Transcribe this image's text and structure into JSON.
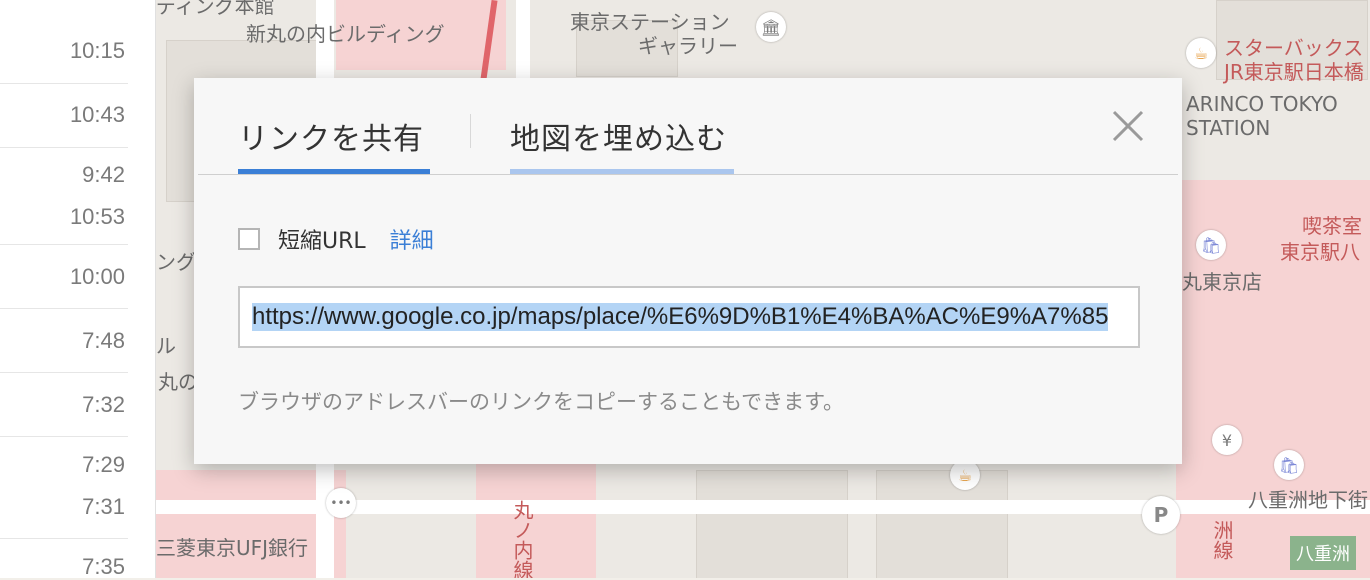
{
  "left_panel": {
    "times": [
      "10:15",
      "10:43",
      "9:42",
      "10:53",
      "10:00",
      "7:48",
      "7:32",
      "7:29",
      "7:31",
      "7:35"
    ]
  },
  "map": {
    "labels": {
      "building_top": "ディング本館",
      "shinmarunouchi": "新丸の内ビルディング",
      "station_gallery_1": "東京ステーション",
      "station_gallery_2": "ギャラリー",
      "starbucks_1": "スターバックス",
      "starbucks_2": "JR東京駅日本橋",
      "arinco_1": "ARINCO TOKYO",
      "arinco_2": "STATION",
      "kissa_1": "喫茶室",
      "kissa_2": "東京駅八",
      "daimaru": "丸東京店",
      "left_ng": "ング",
      "left_ru": "ル",
      "left_maruno": "丸の",
      "mufg": "三菱東京UFJ銀行",
      "marunouchi_line": "丸ノ内線",
      "yaesu_chika": "八重洲地下街",
      "yaesu_line": "洲線",
      "yaesu_badge": "八重洲"
    },
    "icons": [
      "museum-icon",
      "cafe-icon",
      "shopping-bag-icon",
      "yen-icon",
      "parking-icon",
      "traffic-light-icon"
    ]
  },
  "dialog": {
    "tabs": [
      {
        "label": "リンクを共有",
        "underline_color": "#3b7fd6"
      },
      {
        "label": "地図を埋め込む",
        "underline_color": "#aac6ee"
      }
    ],
    "short_url_label": "短縮URL",
    "details_link": "詳細",
    "url_value": "https://www.google.co.jp/maps/place/%E6%9D%B1%E4%BA%AC%E9%A7%85",
    "hint": "ブラウザのアドレスバーのリンクをコピーすることもできます。"
  }
}
